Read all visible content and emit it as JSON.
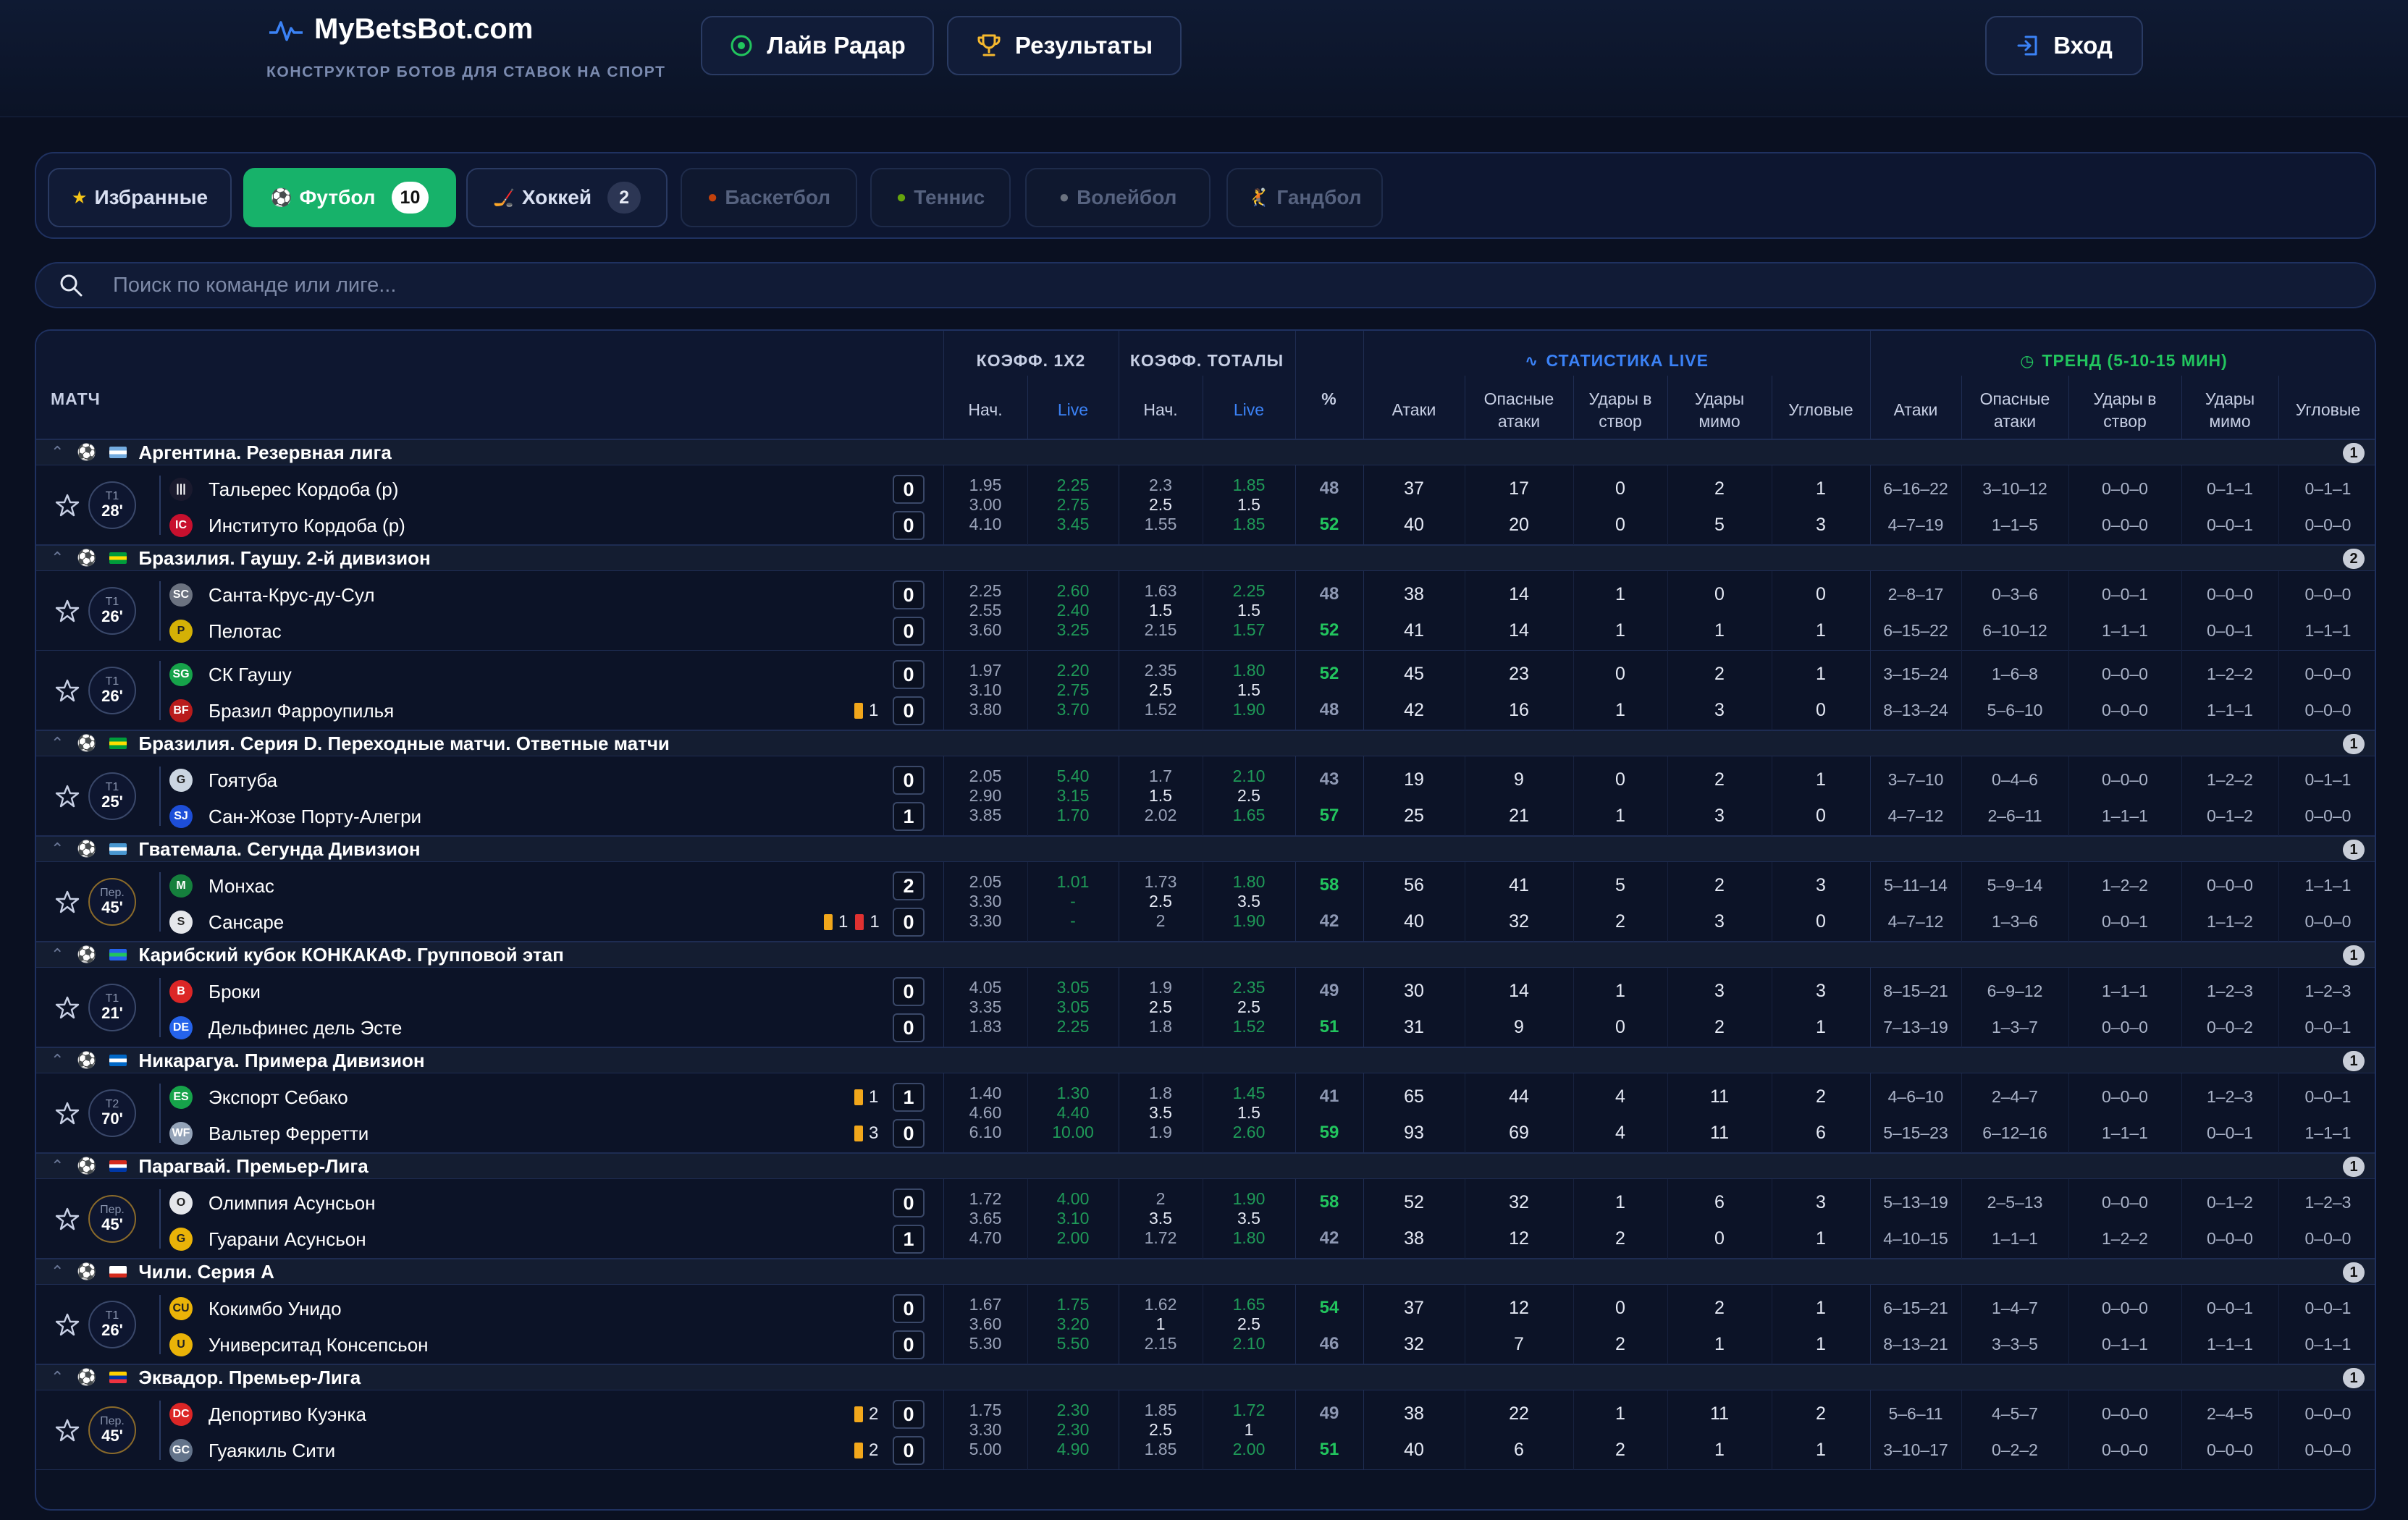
{
  "header": {
    "logo": "MyBetsBot.com",
    "tagline": "КОНСТРУКТОР БОТОВ ДЛЯ СТАВОК НА СПОРТ",
    "nav": [
      {
        "label": "Лайв Радар",
        "icon": "radar-icon"
      },
      {
        "label": "Результаты",
        "icon": "trophy-icon"
      }
    ],
    "login": "Вход"
  },
  "tabs": [
    {
      "label": "Избранные",
      "icon": "star-icon",
      "count": ""
    },
    {
      "label": "Футбол",
      "icon": "soccer-ball-icon",
      "count": "10",
      "active": true
    },
    {
      "label": "Хоккей",
      "icon": "hockey-stick-icon",
      "count": "2"
    },
    {
      "label": "Баскетбол",
      "icon": "basketball-icon",
      "count": "",
      "disabled": true
    },
    {
      "label": "Теннис",
      "icon": "tennis-ball-icon",
      "count": "",
      "disabled": true
    },
    {
      "label": "Волейбол",
      "icon": "volleyball-icon",
      "count": "",
      "disabled": true
    },
    {
      "label": "Гандбол",
      "icon": "handball-icon",
      "count": "",
      "disabled": true
    }
  ],
  "search": {
    "placeholder": "Поиск по команде или лиге..."
  },
  "table": {
    "h_match": "МАТЧ",
    "h_1x2": "КОЭФФ. 1X2",
    "h_totals": "КОЭФФ. ТОТАЛЫ",
    "h_start": "Нач.",
    "h_live": "Live",
    "h_pct": "%",
    "h_stats": "СТАТИСТИКА LIVE",
    "h_trend": "ТРЕНД (5-10-15 МИН)",
    "h_attacks": "Атаки",
    "h_dang": [
      "Опасные",
      "атаки"
    ],
    "h_on": [
      "Удары в",
      "створ"
    ],
    "h_off": [
      "Удары",
      "мимо"
    ],
    "h_corners": "Угловые"
  },
  "colors": {
    "accent": "#17b26a",
    "live": "#3b82f6",
    "trend": "#22c55e",
    "bg": "#0a1021"
  },
  "leagues": [
    {
      "name": "Аргентина. Резервная лига",
      "count": "1",
      "flag": [
        "#74acdf",
        "#ffffff",
        "#74acdf"
      ],
      "matches": [
        {
          "period": "Т1",
          "minute": "28'",
          "teams": [
            {
              "name": "Тальерес Кордоба (р)",
              "icon": "#1a1a2e",
              "glyph": "|||",
              "score": "0",
              "yellow": "",
              "red": "",
              "stat": [
                "37",
                "17",
                "0",
                "2",
                "1"
              ],
              "trend": [
                "6–16–22",
                "3–10–12",
                "0–0–0",
                "0–1–1",
                "0–1–1"
              ],
              "pct": "48"
            },
            {
              "name": "Институто Кордоба (р)",
              "icon": "#c8102e",
              "glyph": "IC",
              "score": "0",
              "yellow": "",
              "red": "",
              "stat": [
                "40",
                "20",
                "0",
                "5",
                "3"
              ],
              "trend": [
                "4–7–19",
                "1–1–5",
                "0–0–0",
                "0–0–1",
                "0–0–0"
              ],
              "pct": "52"
            }
          ],
          "odds_start": [
            "1.95",
            "3.00",
            "4.10"
          ],
          "odds_live": [
            "2.25",
            "2.75",
            "3.45"
          ],
          "tot_start": [
            "2.3",
            "2.5",
            "1.55"
          ],
          "tot_live": [
            "1.85",
            "1.5",
            "1.85"
          ],
          "hi": 1
        }
      ]
    },
    {
      "name": "Бразилия. Гаушу. 2-й дивизион",
      "count": "2",
      "flag": [
        "#009c3b",
        "#ffdf00",
        "#009c3b"
      ],
      "matches": [
        {
          "period": "Т1",
          "minute": "26'",
          "teams": [
            {
              "name": "Санта-Крус-ду-Сул",
              "icon": "#6b7280",
              "glyph": "SC",
              "score": "0",
              "yellow": "",
              "red": "",
              "stat": [
                "38",
                "14",
                "1",
                "0",
                "0"
              ],
              "trend": [
                "2–8–17",
                "0–3–6",
                "0–0–1",
                "0–0–0",
                "0–0–0"
              ],
              "pct": "48"
            },
            {
              "name": "Пелотас",
              "icon": "#d4b106",
              "glyph": "P",
              "score": "0",
              "yellow": "",
              "red": "",
              "stat": [
                "41",
                "14",
                "1",
                "1",
                "1"
              ],
              "trend": [
                "6–15–22",
                "6–10–12",
                "1–1–1",
                "0–0–1",
                "1–1–1"
              ],
              "pct": "52"
            }
          ],
          "odds_start": [
            "2.25",
            "2.55",
            "3.60"
          ],
          "odds_live": [
            "2.60",
            "2.40",
            "3.25"
          ],
          "tot_start": [
            "1.63",
            "1.5",
            "2.15"
          ],
          "tot_live": [
            "2.25",
            "1.5",
            "1.57"
          ],
          "hi": 1
        },
        {
          "period": "Т1",
          "minute": "26'",
          "teams": [
            {
              "name": "СК Гаушу",
              "icon": "#16a34a",
              "glyph": "SG",
              "score": "0",
              "yellow": "",
              "red": "",
              "stat": [
                "45",
                "23",
                "0",
                "2",
                "1"
              ],
              "trend": [
                "3–15–24",
                "1–6–8",
                "0–0–0",
                "1–2–2",
                "0–0–0"
              ],
              "pct": "52"
            },
            {
              "name": "Бразил Фарроупилья",
              "icon": "#b91c1c",
              "glyph": "BF",
              "score": "0",
              "yellow": "1",
              "red": "",
              "stat": [
                "42",
                "16",
                "1",
                "3",
                "0"
              ],
              "trend": [
                "8–13–24",
                "5–6–10",
                "0–0–0",
                "1–1–1",
                "0–0–0"
              ],
              "pct": "48"
            }
          ],
          "odds_start": [
            "1.97",
            "3.10",
            "3.80"
          ],
          "odds_live": [
            "2.20",
            "2.75",
            "3.70"
          ],
          "tot_start": [
            "2.35",
            "2.5",
            "1.52"
          ],
          "tot_live": [
            "1.80",
            "1.5",
            "1.90"
          ],
          "hi": 0
        }
      ]
    },
    {
      "name": "Бразилия. Серия D. Переходные матчи. Ответные матчи",
      "count": "1",
      "flag": [
        "#009c3b",
        "#ffdf00",
        "#009c3b"
      ],
      "matches": [
        {
          "period": "Т1",
          "minute": "25'",
          "teams": [
            {
              "name": "Гоятуба",
              "icon": "#cbd5e1",
              "glyph": "G",
              "score": "0",
              "yellow": "",
              "red": "",
              "stat": [
                "19",
                "9",
                "0",
                "2",
                "1"
              ],
              "trend": [
                "3–7–10",
                "0–4–6",
                "0–0–0",
                "1–2–2",
                "0–1–1"
              ],
              "pct": "43"
            },
            {
              "name": "Сан-Жозе Порту-Алегри",
              "icon": "#1d4ed8",
              "glyph": "SJ",
              "score": "1",
              "yellow": "",
              "red": "",
              "stat": [
                "25",
                "21",
                "1",
                "3",
                "0"
              ],
              "trend": [
                "4–7–12",
                "2–6–11",
                "1–1–1",
                "0–1–2",
                "0–0–0"
              ],
              "pct": "57"
            }
          ],
          "odds_start": [
            "2.05",
            "2.90",
            "3.85"
          ],
          "odds_live": [
            "5.40",
            "3.15",
            "1.70"
          ],
          "tot_start": [
            "1.7",
            "1.5",
            "2.02"
          ],
          "tot_live": [
            "2.10",
            "2.5",
            "1.65"
          ],
          "hi": 1
        }
      ]
    },
    {
      "name": "Гватемала. Сегунда Дивизион",
      "count": "1",
      "flag": [
        "#4997d0",
        "#ffffff",
        "#4997d0"
      ],
      "matches": [
        {
          "period": "Пер.",
          "minute": "45'",
          "ht": true,
          "teams": [
            {
              "name": "Монхас",
              "icon": "#15803d",
              "glyph": "M",
              "score": "2",
              "yellow": "",
              "red": "",
              "stat": [
                "56",
                "41",
                "5",
                "2",
                "3"
              ],
              "trend": [
                "5–11–14",
                "5–9–14",
                "1–2–2",
                "0–0–0",
                "1–1–1"
              ],
              "pct": "58"
            },
            {
              "name": "Сансаре",
              "icon": "#e5e7eb",
              "glyph": "S",
              "score": "0",
              "yellow": "1",
              "red": "1",
              "stat": [
                "40",
                "32",
                "2",
                "3",
                "0"
              ],
              "trend": [
                "4–7–12",
                "1–3–6",
                "0–0–1",
                "1–1–2",
                "0–0–0"
              ],
              "pct": "42"
            }
          ],
          "odds_start": [
            "2.05",
            "3.30",
            "3.30"
          ],
          "odds_live": [
            "1.01",
            "-",
            "-"
          ],
          "tot_start": [
            "1.73",
            "2.5",
            "2"
          ],
          "tot_live": [
            "1.80",
            "3.5",
            "1.90"
          ],
          "hi": 0
        }
      ]
    },
    {
      "name": "Карибский кубок КОНКАКАФ. Групповой этап",
      "count": "1",
      "flag": [
        "#2563eb",
        "#22c55e",
        "#2563eb"
      ],
      "matches": [
        {
          "period": "Т1",
          "minute": "21'",
          "teams": [
            {
              "name": "Броки",
              "icon": "#dc2626",
              "glyph": "B",
              "score": "0",
              "yellow": "",
              "red": "",
              "stat": [
                "30",
                "14",
                "1",
                "3",
                "3"
              ],
              "trend": [
                "8–15–21",
                "6–9–12",
                "1–1–1",
                "1–2–3",
                "1–2–3"
              ],
              "pct": "49"
            },
            {
              "name": "Дельфинес дель Эсте",
              "icon": "#2563eb",
              "glyph": "DE",
              "score": "0",
              "yellow": "",
              "red": "",
              "stat": [
                "31",
                "9",
                "0",
                "2",
                "1"
              ],
              "trend": [
                "7–13–19",
                "1–3–7",
                "0–0–0",
                "0–0–2",
                "0–0–1"
              ],
              "pct": "51"
            }
          ],
          "odds_start": [
            "4.05",
            "3.35",
            "1.83"
          ],
          "odds_live": [
            "3.05",
            "3.05",
            "2.25"
          ],
          "tot_start": [
            "1.9",
            "2.5",
            "1.8"
          ],
          "tot_live": [
            "2.35",
            "2.5",
            "1.52"
          ],
          "hi": 1
        }
      ]
    },
    {
      "name": "Никарагуа. Примера Дивизион",
      "count": "1",
      "flag": [
        "#0067c6",
        "#ffffff",
        "#0067c6"
      ],
      "matches": [
        {
          "period": "Т2",
          "minute": "70'",
          "teams": [
            {
              "name": "Экспорт Себако",
              "icon": "#16a34a",
              "glyph": "ES",
              "score": "1",
              "yellow": "1",
              "red": "",
              "stat": [
                "65",
                "44",
                "4",
                "11",
                "2"
              ],
              "trend": [
                "4–6–10",
                "2–4–7",
                "0–0–0",
                "1–2–3",
                "0–0–1"
              ],
              "pct": "41"
            },
            {
              "name": "Вальтер Ферретти",
              "icon": "#94a3b8",
              "glyph": "WF",
              "score": "0",
              "yellow": "3",
              "red": "",
              "stat": [
                "93",
                "69",
                "4",
                "11",
                "6"
              ],
              "trend": [
                "5–15–23",
                "6–12–16",
                "1–1–1",
                "0–0–1",
                "1–1–1"
              ],
              "pct": "59"
            }
          ],
          "odds_start": [
            "1.40",
            "4.60",
            "6.10"
          ],
          "odds_live": [
            "1.30",
            "4.40",
            "10.00"
          ],
          "tot_start": [
            "1.8",
            "3.5",
            "1.9"
          ],
          "tot_live": [
            "1.45",
            "1.5",
            "2.60"
          ],
          "hi": 1
        }
      ]
    },
    {
      "name": "Парагвай. Премьер-Лига",
      "count": "1",
      "flag": [
        "#d52b1e",
        "#ffffff",
        "#0038a8"
      ],
      "matches": [
        {
          "period": "Пер.",
          "minute": "45'",
          "ht": true,
          "teams": [
            {
              "name": "Олимпия Асунсьон",
              "icon": "#e5e7eb",
              "glyph": "O",
              "score": "0",
              "yellow": "",
              "red": "",
              "stat": [
                "52",
                "32",
                "1",
                "6",
                "3"
              ],
              "trend": [
                "5–13–19",
                "2–5–13",
                "0–0–0",
                "0–1–2",
                "1–2–3"
              ],
              "pct": "58"
            },
            {
              "name": "Гуарани Асунсьон",
              "icon": "#eab308",
              "glyph": "G",
              "score": "1",
              "yellow": "",
              "red": "",
              "stat": [
                "38",
                "12",
                "2",
                "0",
                "1"
              ],
              "trend": [
                "4–10–15",
                "1–1–1",
                "1–2–2",
                "0–0–0",
                "0–0–0"
              ],
              "pct": "42"
            }
          ],
          "odds_start": [
            "1.72",
            "3.65",
            "4.70"
          ],
          "odds_live": [
            "4.00",
            "3.10",
            "2.00"
          ],
          "tot_start": [
            "2",
            "3.5",
            "1.72"
          ],
          "tot_live": [
            "1.90",
            "3.5",
            "1.80"
          ],
          "hi": 0
        }
      ]
    },
    {
      "name": "Чили. Серия А",
      "count": "1",
      "flag": [
        "#ffffff",
        "#ffffff",
        "#d52b1e"
      ],
      "matches": [
        {
          "period": "Т1",
          "minute": "26'",
          "teams": [
            {
              "name": "Кокимбо Унидо",
              "icon": "#eab308",
              "glyph": "CU",
              "score": "0",
              "yellow": "",
              "red": "",
              "stat": [
                "37",
                "12",
                "0",
                "2",
                "1"
              ],
              "trend": [
                "6–15–21",
                "1–4–7",
                "0–0–0",
                "0–0–1",
                "0–0–1"
              ],
              "pct": "54"
            },
            {
              "name": "Университад Консепсьон",
              "icon": "#eab308",
              "glyph": "U",
              "score": "0",
              "yellow": "",
              "red": "",
              "stat": [
                "32",
                "7",
                "2",
                "1",
                "1"
              ],
              "trend": [
                "8–13–21",
                "3–3–5",
                "0–1–1",
                "1–1–1",
                "0–1–1"
              ],
              "pct": "46"
            }
          ],
          "odds_start": [
            "1.67",
            "3.60",
            "5.30"
          ],
          "odds_live": [
            "1.75",
            "3.20",
            "5.50"
          ],
          "tot_start": [
            "1.62",
            "1",
            "2.15"
          ],
          "tot_live": [
            "1.65",
            "2.5",
            "2.10"
          ],
          "hi": 0
        }
      ]
    },
    {
      "name": "Эквадор. Премьер-Лига",
      "count": "1",
      "flag": [
        "#ffd100",
        "#0033a0",
        "#ef3340"
      ],
      "matches": [
        {
          "period": "Пер.",
          "minute": "45'",
          "ht": true,
          "teams": [
            {
              "name": "Депортиво Куэнка",
              "icon": "#dc2626",
              "glyph": "DC",
              "score": "0",
              "yellow": "2",
              "red": "",
              "stat": [
                "38",
                "22",
                "1",
                "11",
                "2"
              ],
              "trend": [
                "5–6–11",
                "4–5–7",
                "0–0–0",
                "2–4–5",
                "0–0–0"
              ],
              "pct": "49"
            },
            {
              "name": "Гуаякиль Сити",
              "icon": "#64748b",
              "glyph": "GC",
              "score": "0",
              "yellow": "2",
              "red": "",
              "stat": [
                "40",
                "6",
                "2",
                "1",
                "1"
              ],
              "trend": [
                "3–10–17",
                "0–2–2",
                "0–0–0",
                "0–0–0",
                "0–0–0"
              ],
              "pct": "51"
            }
          ],
          "odds_start": [
            "1.75",
            "3.30",
            "5.00"
          ],
          "odds_live": [
            "2.30",
            "2.30",
            "4.90"
          ],
          "tot_start": [
            "1.85",
            "2.5",
            "1.85"
          ],
          "tot_live": [
            "1.72",
            "1",
            "2.00"
          ],
          "hi": 1
        }
      ]
    }
  ]
}
